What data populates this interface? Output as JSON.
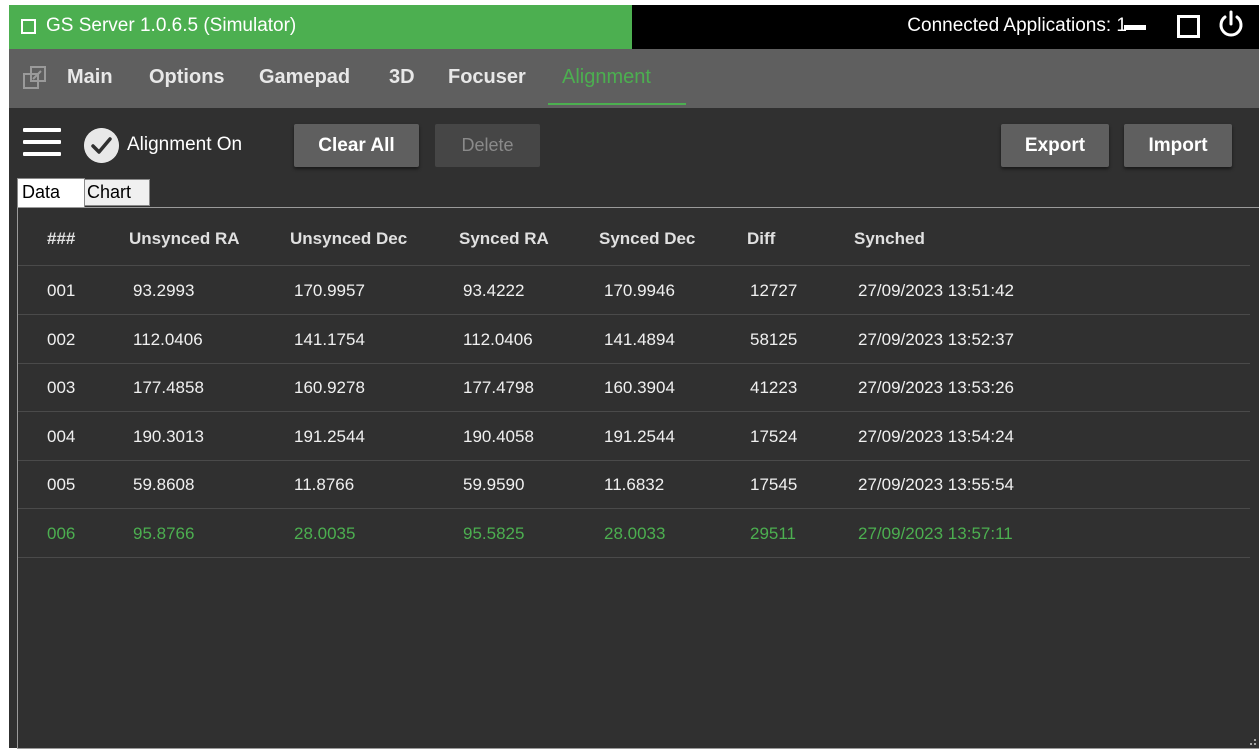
{
  "window": {
    "title": "GS Server 1.0.6.5 (Simulator)",
    "connected_label": "Connected Applications: 1"
  },
  "nav": {
    "tabs": [
      {
        "label": "Main"
      },
      {
        "label": "Options"
      },
      {
        "label": "Gamepad"
      },
      {
        "label": "3D"
      },
      {
        "label": "Focuser"
      },
      {
        "label": "Alignment",
        "active": true
      }
    ]
  },
  "toolbar": {
    "alignment_label": "Alignment On",
    "alignment_on": true,
    "clear_label": "Clear All",
    "delete_label": "Delete",
    "export_label": "Export",
    "import_label": "Import"
  },
  "subtabs": {
    "data_label": "Data",
    "chart_label": "Chart"
  },
  "table": {
    "columns": [
      "###",
      "Unsynced RA",
      "Unsynced Dec",
      "Synced RA",
      "Synced Dec",
      "Diff",
      "Synched"
    ],
    "rows": [
      [
        "001",
        "93.2993",
        "170.9957",
        "93.4222",
        "170.9946",
        "12727",
        "27/09/2023 13:51:42"
      ],
      [
        "002",
        "112.0406",
        "141.1754",
        "112.0406",
        "141.4894",
        "58125",
        "27/09/2023 13:52:37"
      ],
      [
        "003",
        "177.4858",
        "160.9278",
        "177.4798",
        "160.3904",
        "41223",
        "27/09/2023 13:53:26"
      ],
      [
        "004",
        "190.3013",
        "191.2544",
        "190.4058",
        "191.2544",
        "17524",
        "27/09/2023 13:54:24"
      ],
      [
        "005",
        "59.8608",
        "11.8766",
        "59.9590",
        "11.6832",
        "17545",
        "27/09/2023 13:55:54"
      ],
      [
        "006",
        "95.8766",
        "28.0035",
        "95.5825",
        "28.0033",
        "29511",
        "27/09/2023 13:57:11"
      ]
    ],
    "selected_row": 5
  },
  "colors": {
    "accent": "#4caf50",
    "nav_bg": "#5f5f5f",
    "content_bg": "#303030"
  }
}
